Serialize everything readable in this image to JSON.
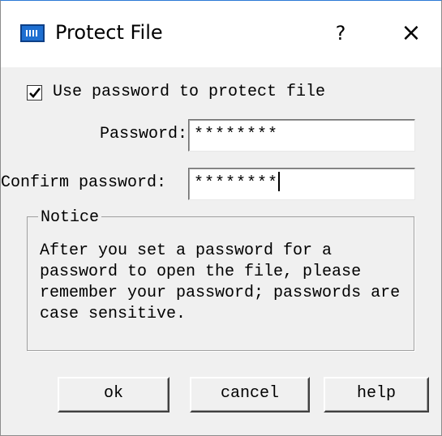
{
  "window": {
    "title": "Protect File",
    "help_icon": "?",
    "close_icon": "×",
    "icons": {
      "app": "app-logo-icon",
      "help": "question-icon",
      "close": "close-icon"
    }
  },
  "options": {
    "use_password_label": "Use password to protect file",
    "use_password_checked": true
  },
  "fields": {
    "password": {
      "label": "Password:",
      "value": "********"
    },
    "confirm": {
      "label": "Confirm password:",
      "value": "********"
    }
  },
  "notice": {
    "title": "Notice",
    "text": "After you set a password for a\npassword to open the file, please\nremember your password; passwords are\ncase sensitive."
  },
  "buttons": {
    "ok": "ok",
    "cancel": "cancel",
    "help": "help"
  },
  "colors": {
    "accent": "#1e6fd1",
    "title_bar": "#ffffff",
    "dialog_bg": "#f0f0f0"
  }
}
